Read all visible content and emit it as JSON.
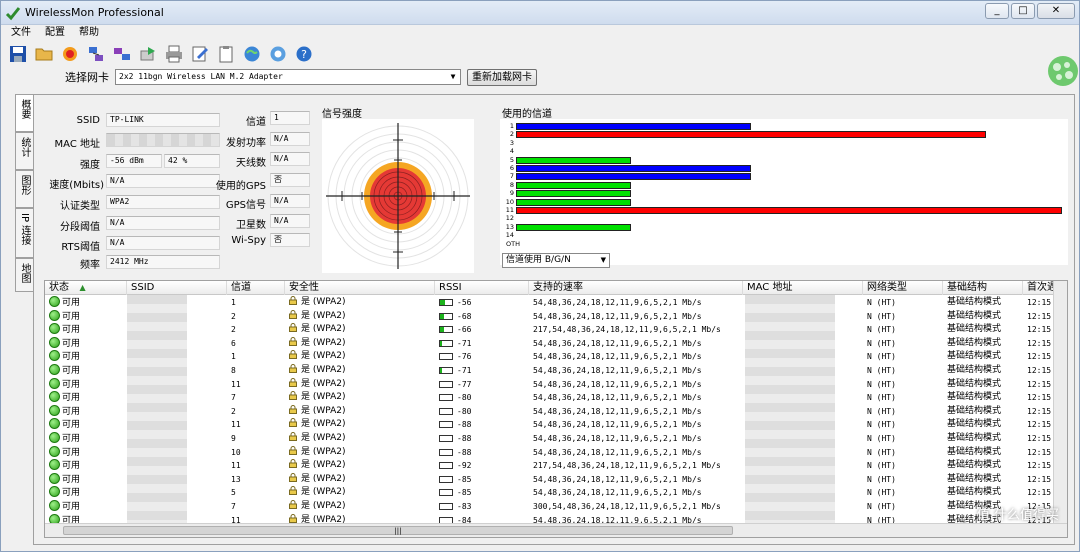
{
  "window": {
    "title": "WirelessMon Professional",
    "min": "_",
    "max": "□",
    "close": "✕"
  },
  "menu": [
    "文件",
    "配置",
    "帮助"
  ],
  "toolbar": [
    "save-icon",
    "open-folder-icon",
    "record-icon",
    "network-icon",
    "network-alt-icon",
    "export-icon",
    "print-icon",
    "edit-icon",
    "clipboard-icon",
    "globe-icon",
    "help-web-icon",
    "help-icon"
  ],
  "adapter": {
    "label": "选择网卡",
    "value": "2x2 11bgn Wireless LAN M.2 Adapter",
    "reload": "重新加载网卡"
  },
  "sidetabs": [
    "概要",
    "统计",
    "图形",
    "IP 连接",
    "地图"
  ],
  "info": {
    "ssid_label": "SSID",
    "ssid": "TP-LINK",
    "mac_label": "MAC 地址",
    "mac": "",
    "strength_label": "强度",
    "strength_dbm": "-56 dBm",
    "strength_pct": "42 %",
    "speed_label": "速度(Mbits)",
    "speed": "N/A",
    "auth_label": "认证类型",
    "auth": "WPA2",
    "frag_label": "分段阈值",
    "frag": "N/A",
    "rts_label": "RTS阈值",
    "rts": "N/A",
    "freq_label": "频率",
    "freq": "2412 MHz",
    "channel_label": "信道",
    "channel": "1",
    "txpower_label": "发射功率",
    "txpower": "N/A",
    "antenna_label": "天线数",
    "antenna": "N/A",
    "gps_used_label": "使用的GPS",
    "gps_used": "否",
    "gps_signal_label": "GPS信号",
    "gps_signal": "N/A",
    "satellite_label": "卫星数",
    "satellite": "N/A",
    "wispy_label": "Wi-Spy",
    "wispy": "否"
  },
  "signal": {
    "title": "信号强度"
  },
  "channels": {
    "title": "使用的信道",
    "labels": [
      "1",
      "2",
      "3",
      "4",
      "5",
      "6",
      "7",
      "8",
      "9",
      "10",
      "11",
      "12",
      "13",
      "14",
      "OTH"
    ],
    "select": "信道使用 B/G/N",
    "bars": [
      {
        "ch": "1",
        "len": 0.43,
        "color": "#0000ff"
      },
      {
        "ch": "2",
        "len": 0.86,
        "color": "#ff0000"
      },
      {
        "ch": "5",
        "len": 0.21,
        "color": "#00e000"
      },
      {
        "ch": "6",
        "len": 0.43,
        "color": "#0000ff"
      },
      {
        "ch": "7",
        "len": 0.43,
        "color": "#0000ff"
      },
      {
        "ch": "8",
        "len": 0.21,
        "color": "#00e000"
      },
      {
        "ch": "9",
        "len": 0.21,
        "color": "#00e000"
      },
      {
        "ch": "10",
        "len": 0.21,
        "color": "#00e000"
      },
      {
        "ch": "11",
        "len": 1.0,
        "color": "#ff0000"
      },
      {
        "ch": "13",
        "len": 0.21,
        "color": "#00e000"
      }
    ]
  },
  "table": {
    "headers": [
      "状态",
      "SSID",
      "信道",
      "安全性",
      "RSSI",
      "支持的速率",
      "MAC 地址",
      "网络类型",
      "基础结构",
      "首次遇"
    ],
    "rows": [
      {
        "status": "可用",
        "ssid": "TP-LINK",
        "ch": "1",
        "sec": "是 (WPA2)",
        "rssi": "-56",
        "lvl": 0.42,
        "rates": "54,48,36,24,18,12,11,9,6,5,2,1 Mb/s",
        "net": "N (HT)",
        "infra": "基础结构模式",
        "first": "12:15"
      },
      {
        "status": "可用",
        "ssid": "",
        "ch": "2",
        "sec": "是 (WPA2)",
        "rssi": "-68",
        "lvl": 0.3,
        "rates": "54,48,36,24,18,12,11,9,6,5,2,1 Mb/s",
        "net": "N (HT)",
        "infra": "基础结构模式",
        "first": "12:15"
      },
      {
        "status": "可用",
        "ssid": "",
        "ch": "2",
        "sec": "是 (WPA2)",
        "rssi": "-66",
        "lvl": 0.3,
        "rates": "217,54,48,36,24,18,12,11,9,6,5,2,1 Mb/s",
        "net": "N (HT)",
        "infra": "基础结构模式",
        "first": "12:15"
      },
      {
        "status": "可用",
        "ssid": "",
        "ch": "6",
        "sec": "是 (WPA2)",
        "rssi": "-71",
        "lvl": 0.15,
        "rates": "54,48,36,24,18,12,11,9,6,5,2,1 Mb/s",
        "net": "N (HT)",
        "infra": "基础结构模式",
        "first": "12:15"
      },
      {
        "status": "可用",
        "ssid": "",
        "ch": "1",
        "sec": "是 (WPA2)",
        "rssi": "-76",
        "lvl": 0,
        "rates": "54,48,36,24,18,12,11,9,6,5,2,1 Mb/s",
        "net": "N (HT)",
        "infra": "基础结构模式",
        "first": "12:15"
      },
      {
        "status": "可用",
        "ssid": "",
        "ch": "8",
        "sec": "是 (WPA2)",
        "rssi": "-71",
        "lvl": 0.15,
        "rates": "54,48,36,24,18,12,11,9,6,5,2,1 Mb/s",
        "net": "N (HT)",
        "infra": "基础结构模式",
        "first": "12:15"
      },
      {
        "status": "可用",
        "ssid": "",
        "ch": "11",
        "sec": "是 (WPA2)",
        "rssi": "-77",
        "lvl": 0,
        "rates": "54,48,36,24,18,12,11,9,6,5,2,1 Mb/s",
        "net": "N (HT)",
        "infra": "基础结构模式",
        "first": "12:15"
      },
      {
        "status": "可用",
        "ssid": "",
        "ch": "7",
        "sec": "是 (WPA2)",
        "rssi": "-80",
        "lvl": 0,
        "rates": "54,48,36,24,18,12,11,9,6,5,2,1 Mb/s",
        "net": "N (HT)",
        "infra": "基础结构模式",
        "first": "12:15"
      },
      {
        "status": "可用",
        "ssid": "",
        "ch": "2",
        "sec": "是 (WPA2)",
        "rssi": "-80",
        "lvl": 0,
        "rates": "54,48,36,24,18,12,11,9,6,5,2,1 Mb/s",
        "net": "N (HT)",
        "infra": "基础结构模式",
        "first": "12:15"
      },
      {
        "status": "可用",
        "ssid": "",
        "ch": "11",
        "sec": "是 (WPA2)",
        "rssi": "-88",
        "lvl": 0,
        "rates": "54,48,36,24,18,12,11,9,6,5,2,1 Mb/s",
        "net": "N (HT)",
        "infra": "基础结构模式",
        "first": "12:15"
      },
      {
        "status": "可用",
        "ssid": "",
        "ch": "9",
        "sec": "是 (WPA2)",
        "rssi": "-88",
        "lvl": 0,
        "rates": "54,48,36,24,18,12,11,9,6,5,2,1 Mb/s",
        "net": "N (HT)",
        "infra": "基础结构模式",
        "first": "12:15"
      },
      {
        "status": "可用",
        "ssid": "",
        "ch": "10",
        "sec": "是 (WPA2)",
        "rssi": "-88",
        "lvl": 0,
        "rates": "54,48,36,24,18,12,11,9,6,5,2,1 Mb/s",
        "net": "N (HT)",
        "infra": "基础结构模式",
        "first": "12:15"
      },
      {
        "status": "可用",
        "ssid": "",
        "ch": "11",
        "sec": "是 (WPA2)",
        "rssi": "-92",
        "lvl": 0,
        "rates": "217,54,48,36,24,18,12,11,9,6,5,2,1 Mb/s",
        "net": "N (HT)",
        "infra": "基础结构模式",
        "first": "12:15"
      },
      {
        "status": "可用",
        "ssid": "",
        "ch": "13",
        "sec": "是 (WPA2)",
        "rssi": "-85",
        "lvl": 0,
        "rates": "54,48,36,24,18,12,11,9,6,5,2,1 Mb/s",
        "net": "N (HT)",
        "infra": "基础结构模式",
        "first": "12:15"
      },
      {
        "status": "可用",
        "ssid": "",
        "ch": "5",
        "sec": "是 (WPA2)",
        "rssi": "-85",
        "lvl": 0,
        "rates": "54,48,36,24,18,12,11,9,6,5,2,1 Mb/s",
        "net": "N (HT)",
        "infra": "基础结构模式",
        "first": "12:15"
      },
      {
        "status": "可用",
        "ssid": "",
        "ch": "7",
        "sec": "是 (WPA2)",
        "rssi": "-83",
        "lvl": 0,
        "rates": "300,54,48,36,24,18,12,11,9,6,5,2,1 Mb/s",
        "net": "N (HT)",
        "infra": "基础结构模式",
        "first": "12:15"
      },
      {
        "status": "可用",
        "ssid": "",
        "ch": "11",
        "sec": "是 (WPA2)",
        "rssi": "-84",
        "lvl": 0,
        "rates": "54,48,36,24,18,12,11,9,6,5,2,1 Mb/s",
        "net": "N (HT)",
        "infra": "基础结构模式",
        "first": "12:15"
      }
    ],
    "scroll_grip": "|||"
  },
  "watermark": "值 什么值得买"
}
